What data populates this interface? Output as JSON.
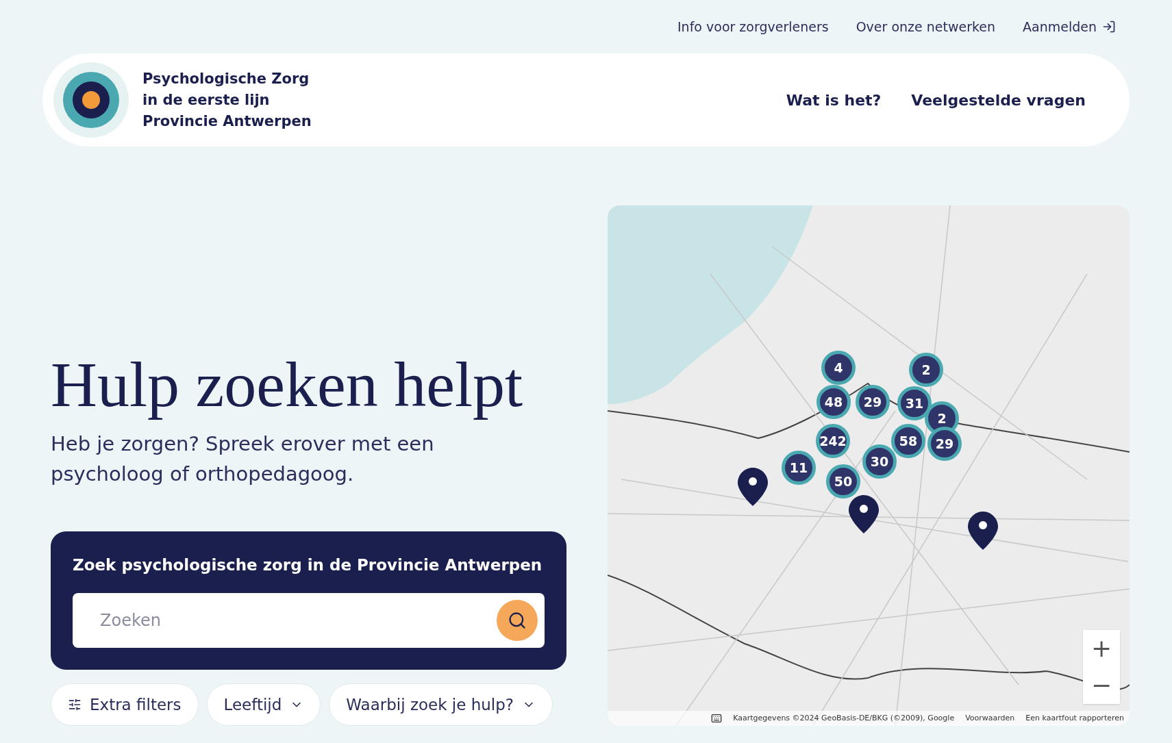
{
  "top_nav": {
    "links": [
      "Info voor zorgverleners",
      "Over onze netwerken"
    ],
    "login": "Aanmelden"
  },
  "header": {
    "logo_lines": [
      "Psychologische Zorg",
      "in de eerste lijn",
      "Provincie Antwerpen"
    ],
    "nav": [
      "Wat is het?",
      "Veelgestelde vragen"
    ]
  },
  "hero": {
    "title": "Hulp zoeken helpt",
    "subtitle": "Heb je zorgen? Spreek erover met een psycholoog of orthopedagoog."
  },
  "search": {
    "heading": "Zoek psychologische zorg in de Provincie Antwerpen",
    "placeholder": "Zoeken"
  },
  "filters": [
    {
      "label": "Extra filters",
      "kind": "filter"
    },
    {
      "label": "Leeftijd",
      "kind": "dropdown"
    },
    {
      "label": "Waarbij zoek je hulp?",
      "kind": "dropdown"
    }
  ],
  "map": {
    "clusters": [
      "4",
      "2",
      "48",
      "29",
      "31",
      "2",
      "242",
      "58",
      "29",
      "11",
      "30",
      "50"
    ],
    "zoom": [
      "+",
      "−"
    ],
    "attribution": [
      "Kaartgegevens ©2024 GeoBasis-DE/BKG (©2009), Google",
      "Voorwaarden",
      "Een kaartfout rapporteren"
    ]
  }
}
